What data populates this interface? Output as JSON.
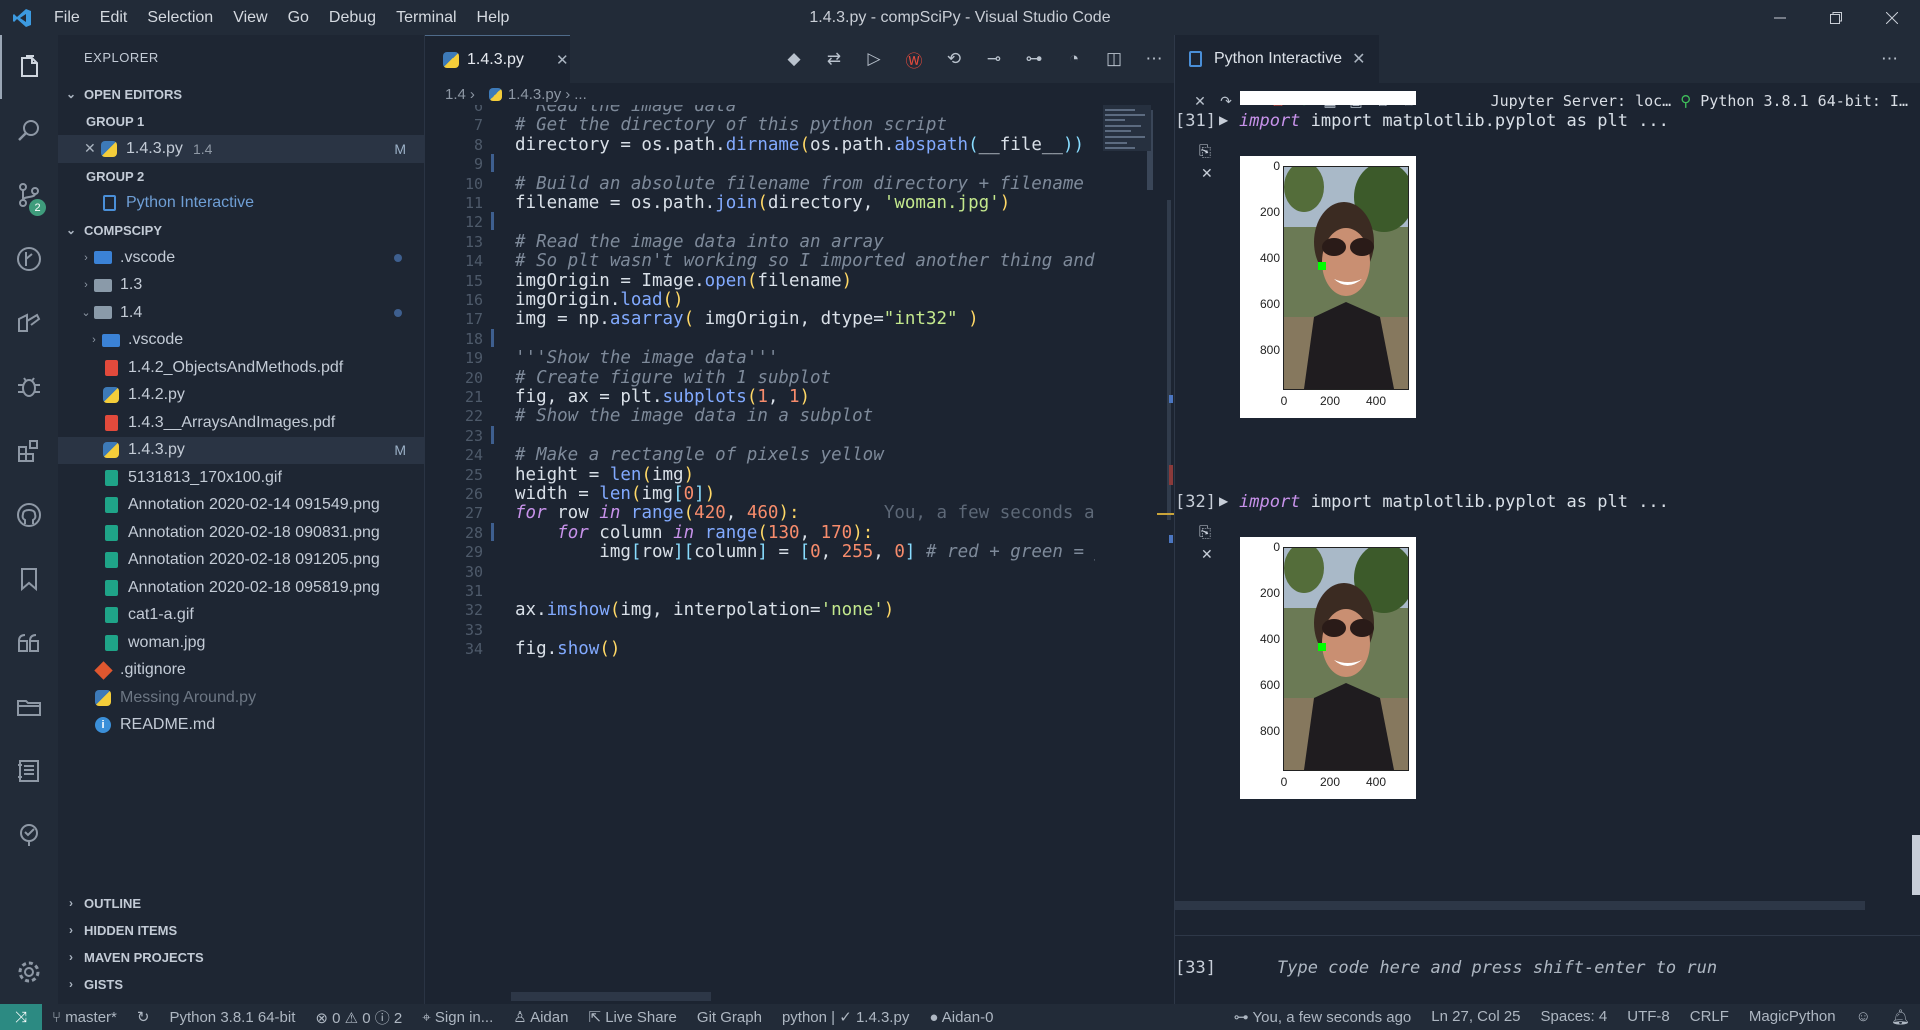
{
  "titlebar": {
    "menu": [
      "File",
      "Edit",
      "Selection",
      "View",
      "Go",
      "Debug",
      "Terminal",
      "Help"
    ],
    "title": "1.4.3.py - compSciPy - Visual Studio Code"
  },
  "activity": {
    "scm_badge": "2"
  },
  "explorer": {
    "title": "EXPLORER",
    "open_editors": "OPEN EDITORS",
    "group1": "GROUP 1",
    "group1_file": {
      "name": "1.4.3.py",
      "dir": "1.4",
      "status": "M"
    },
    "group2": "GROUP 2",
    "group2_file": "Python Interactive",
    "workspace": "COMPSCIPY",
    "tree": [
      {
        "name": ".vscode",
        "type": "folder-vscode",
        "depth": 0,
        "expanded": false,
        "dot": true
      },
      {
        "name": "1.3",
        "type": "folder",
        "depth": 0,
        "expanded": false
      },
      {
        "name": "1.4",
        "type": "folder",
        "depth": 0,
        "expanded": true,
        "dot": true
      },
      {
        "name": ".vscode",
        "type": "folder-vscode",
        "depth": 1,
        "expanded": false
      },
      {
        "name": "1.4.2_ObjectsAndMethods.pdf",
        "type": "pdf",
        "depth": 1
      },
      {
        "name": "1.4.2.py",
        "type": "py",
        "depth": 1
      },
      {
        "name": "1.4.3__ArraysAndImages.pdf",
        "type": "pdf",
        "depth": 1
      },
      {
        "name": "1.4.3.py",
        "type": "py",
        "depth": 1,
        "status": "M",
        "selected": true
      },
      {
        "name": "5131813_170x100.gif",
        "type": "img",
        "depth": 1
      },
      {
        "name": "Annotation 2020-02-14 091549.png",
        "type": "img",
        "depth": 1
      },
      {
        "name": "Annotation 2020-02-18 090831.png",
        "type": "img",
        "depth": 1
      },
      {
        "name": "Annotation 2020-02-18 091205.png",
        "type": "img",
        "depth": 1
      },
      {
        "name": "Annotation 2020-02-18 095819.png",
        "type": "img",
        "depth": 1
      },
      {
        "name": "cat1-a.gif",
        "type": "img",
        "depth": 1
      },
      {
        "name": "woman.jpg",
        "type": "img",
        "depth": 1
      },
      {
        "name": ".gitignore",
        "type": "git",
        "depth": 0
      },
      {
        "name": "Messing Around.py",
        "type": "py",
        "depth": 0,
        "dim": true
      },
      {
        "name": "README.md",
        "type": "info",
        "depth": 0
      }
    ],
    "sections": [
      "OUTLINE",
      "HIDDEN ITEMS",
      "MAVEN PROJECTS",
      "GISTS"
    ]
  },
  "editor": {
    "tab": "1.4.3.py",
    "breadcrumb": [
      "1.4",
      "1.4.3.py",
      "..."
    ],
    "lines": [
      {
        "n": "6",
        "tokens": [
          [
            "cm",
            "  Read the image data"
          ]
        ]
      },
      {
        "n": "7",
        "tokens": [
          [
            "cm",
            "# Get the directory of this python script"
          ]
        ]
      },
      {
        "n": "8",
        "tokens": [
          [
            "",
            "directory = os.path."
          ],
          [
            "fn",
            "dirname"
          ],
          [
            "yb",
            "("
          ],
          [
            "",
            "os.path."
          ],
          [
            "fn",
            "abspath"
          ],
          [
            "op",
            "("
          ],
          [
            "",
            "__file__"
          ],
          [
            "op",
            "))"
          ]
        ]
      },
      {
        "n": "9",
        "tokens": []
      },
      {
        "n": "10",
        "tokens": [
          [
            "cm",
            "# Build an absolute filename from directory + filename"
          ]
        ]
      },
      {
        "n": "11",
        "tokens": [
          [
            "",
            "filename = os.path."
          ],
          [
            "fn",
            "join"
          ],
          [
            "yb",
            "("
          ],
          [
            "",
            "directory, "
          ],
          [
            "st",
            "'woman.jpg'"
          ],
          [
            "yb",
            ")"
          ]
        ]
      },
      {
        "n": "12",
        "tokens": []
      },
      {
        "n": "13",
        "tokens": [
          [
            "cm",
            "# Read the image data into an array"
          ]
        ]
      },
      {
        "n": "14",
        "tokens": [
          [
            "cm",
            "# So plt wasn't working so I imported another thing and"
          ]
        ]
      },
      {
        "n": "15",
        "tokens": [
          [
            "",
            "imgOrigin = Image."
          ],
          [
            "fn",
            "open"
          ],
          [
            "yb",
            "("
          ],
          [
            "",
            "filename"
          ],
          [
            "yb",
            ")"
          ]
        ]
      },
      {
        "n": "16",
        "tokens": [
          [
            "",
            "imgOrigin."
          ],
          [
            "fn",
            "load"
          ],
          [
            "yb",
            "()"
          ]
        ]
      },
      {
        "n": "17",
        "tokens": [
          [
            "",
            "img = np."
          ],
          [
            "fn",
            "asarray"
          ],
          [
            "yb",
            "("
          ],
          [
            "",
            " imgOrigin, dtype="
          ],
          [
            "st",
            "\"int32\""
          ],
          [
            "yb",
            " )"
          ]
        ]
      },
      {
        "n": "18",
        "tokens": []
      },
      {
        "n": "19",
        "tokens": [
          [
            "cm",
            "'''Show the image data'''"
          ]
        ]
      },
      {
        "n": "20",
        "tokens": [
          [
            "cm",
            "# Create figure with 1 subplot"
          ]
        ]
      },
      {
        "n": "21",
        "tokens": [
          [
            "",
            "fig, ax = plt."
          ],
          [
            "fn",
            "subplots"
          ],
          [
            "yb",
            "("
          ],
          [
            "nu",
            "1"
          ],
          [
            "",
            ", "
          ],
          [
            "nu",
            "1"
          ],
          [
            "yb",
            ")"
          ]
        ]
      },
      {
        "n": "22",
        "tokens": [
          [
            "cm",
            "# Show the image data in a subplot"
          ]
        ]
      },
      {
        "n": "23",
        "tokens": []
      },
      {
        "n": "24",
        "tokens": [
          [
            "cm",
            "# Make a rectangle of pixels yellow"
          ]
        ]
      },
      {
        "n": "25",
        "tokens": [
          [
            "",
            "height = "
          ],
          [
            "fn",
            "len"
          ],
          [
            "yb",
            "("
          ],
          [
            "",
            "img"
          ],
          [
            "yb",
            ")"
          ]
        ]
      },
      {
        "n": "26",
        "tokens": [
          [
            "",
            "width = "
          ],
          [
            "fn",
            "len"
          ],
          [
            "yb",
            "("
          ],
          [
            "",
            "img"
          ],
          [
            "op",
            "["
          ],
          [
            "nu",
            "0"
          ],
          [
            "op",
            "]"
          ],
          [
            "yb",
            ")"
          ]
        ]
      },
      {
        "n": "27",
        "tokens": [
          [
            "kw",
            "for"
          ],
          [
            "",
            " row "
          ],
          [
            "kw",
            "in"
          ],
          [
            "",
            " "
          ],
          [
            "fn",
            "range"
          ],
          [
            "yb",
            "("
          ],
          [
            "nu",
            "420"
          ],
          [
            "",
            ", "
          ],
          [
            "nu",
            "460"
          ],
          [
            "yb",
            "):"
          ],
          [
            "hint",
            "        You, a few seconds ago"
          ]
        ]
      },
      {
        "n": "28",
        "tokens": [
          [
            "",
            "    "
          ],
          [
            "kw",
            "for"
          ],
          [
            "",
            " column "
          ],
          [
            "kw",
            "in"
          ],
          [
            "",
            " "
          ],
          [
            "fn",
            "range"
          ],
          [
            "yb",
            "("
          ],
          [
            "nu",
            "130"
          ],
          [
            "",
            ", "
          ],
          [
            "nu",
            "170"
          ],
          [
            "yb",
            "):"
          ]
        ]
      },
      {
        "n": "29",
        "tokens": [
          [
            "",
            "        img"
          ],
          [
            "op",
            "["
          ],
          [
            "",
            "row"
          ],
          [
            "op",
            "]["
          ],
          [
            "",
            "column"
          ],
          [
            "op",
            "]"
          ],
          [
            "",
            " = "
          ],
          [
            "op",
            "["
          ],
          [
            "nu",
            "0"
          ],
          [
            "",
            ", "
          ],
          [
            "nu",
            "255"
          ],
          [
            "",
            ", "
          ],
          [
            "nu",
            "0"
          ],
          [
            "op",
            "]"
          ],
          [
            "cm",
            " # red + green = yellow"
          ]
        ]
      },
      {
        "n": "30",
        "tokens": []
      },
      {
        "n": "31",
        "tokens": []
      },
      {
        "n": "32",
        "tokens": [
          [
            "",
            "ax."
          ],
          [
            "fn",
            "imshow"
          ],
          [
            "yb",
            "("
          ],
          [
            "",
            "img, interpolation="
          ],
          [
            "st",
            "'none'"
          ],
          [
            "yb",
            ")"
          ]
        ]
      },
      {
        "n": "33",
        "tokens": []
      },
      {
        "n": "34",
        "tokens": [
          [
            "",
            "fig."
          ],
          [
            "fn",
            "show"
          ],
          [
            "yb",
            "()"
          ]
        ]
      }
    ]
  },
  "interactive": {
    "tab": "Python Interactive",
    "server": "Jupyter Server: loc…",
    "kernel": "Python 3.8.1 64-bit: I…",
    "cells": [
      {
        "label": "[31]",
        "code": "import matplotlib.pyplot as plt ..."
      },
      {
        "label": "[32]",
        "code": "import matplotlib.pyplot as plt ..."
      }
    ],
    "plot_yticks": [
      "0",
      "200",
      "400",
      "600",
      "800"
    ],
    "plot_xticks": [
      "0",
      "200",
      "400"
    ],
    "input_label": "[33]",
    "input_placeholder": "Type code here and press shift-enter to run"
  },
  "statusbar": {
    "branch": "master*",
    "python": "Python 3.8.1 64-bit",
    "problems": "⊗ 0 ⚠ 0 ⓘ 2",
    "signin": "Sign in...",
    "user": "Aidan",
    "liveshare": "Live Share",
    "gitgraph": "Git Graph",
    "pyfile": "python | ✓ 1.4.3.py",
    "aidan0": "Aidan-0",
    "blame": "You, a few seconds ago",
    "position": "Ln 27, Col 25",
    "spaces": "Spaces: 4",
    "encoding": "UTF-8",
    "eol": "CRLF",
    "lang": "MagicPython"
  }
}
